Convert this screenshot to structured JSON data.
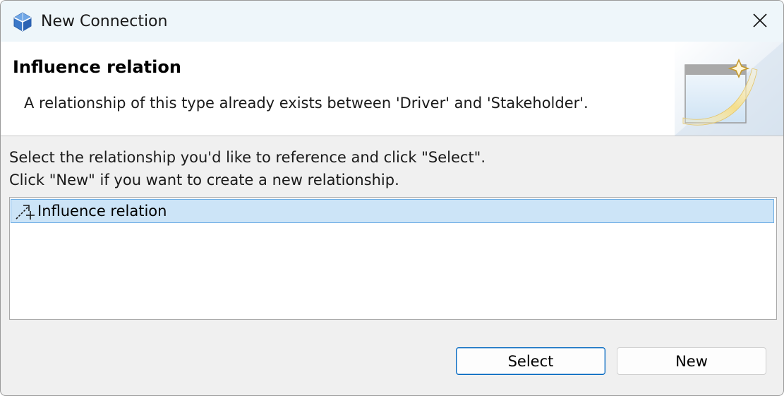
{
  "window": {
    "title": "New Connection",
    "app_icon": "cube-icon",
    "close_icon": "close-icon"
  },
  "banner": {
    "title": "Influence relation",
    "message": "A relationship of this type already exists between 'Driver' and 'Stakeholder'.",
    "image_icon": "new-wizard-icon"
  },
  "instructions": {
    "line1": "Select the relationship you'd like to reference and click \"Select\".",
    "line2": "Click \"New\" if you want to create a new relationship."
  },
  "relationships": {
    "items": [
      {
        "label": "Influence relation",
        "icon": "influence-relation-icon",
        "selected": true
      }
    ]
  },
  "buttons": {
    "select_label": "Select",
    "new_label": "New"
  },
  "colors": {
    "title_bar": "#eef6fa",
    "selection_fill": "#cce4f7",
    "selection_border": "#6eaee5",
    "default_button_border": "#0067c0"
  }
}
